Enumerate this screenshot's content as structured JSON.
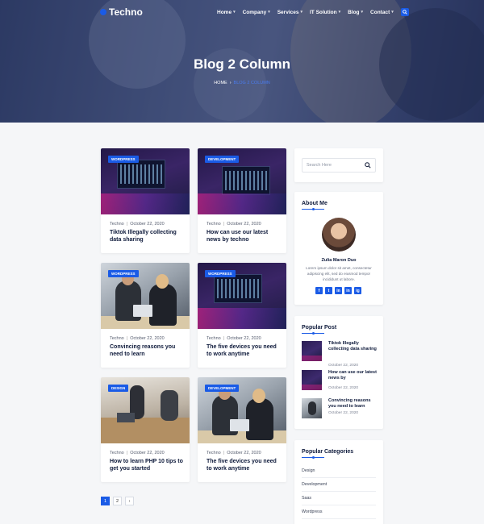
{
  "site": {
    "logo": "Techno"
  },
  "nav": [
    {
      "label": "Home",
      "caret": "▾"
    },
    {
      "label": "Company",
      "caret": "▾"
    },
    {
      "label": "Services",
      "caret": "▾"
    },
    {
      "label": "IT Solution",
      "caret": "▾"
    },
    {
      "label": "Blog",
      "caret": "▾"
    },
    {
      "label": "Contact",
      "caret": "▾"
    }
  ],
  "hero": {
    "title": "Blog 2 Column",
    "breadcrumb": {
      "home": "HOME",
      "separator": "›",
      "current": "BLOG 2 COLUMN"
    }
  },
  "posts": [
    {
      "tag": "WORDPRESS",
      "author": "Techno",
      "date": "October 22, 2020",
      "title": "Tiktok Illegally collecting data sharing",
      "image": "tech"
    },
    {
      "tag": "DEVELOPMENT",
      "author": "Techno",
      "date": "October 22, 2020",
      "title": "How can use our latest news by techno",
      "image": "tech"
    },
    {
      "tag": "WORDPRESS",
      "author": "Techno",
      "date": "October 22, 2020",
      "title": "Convincing reasons you need to learn",
      "image": "office"
    },
    {
      "tag": "WORDPRESS",
      "author": "Techno",
      "date": "October 22, 2020",
      "title": "The five devices you need to work anytime",
      "image": "tech"
    },
    {
      "tag": "DESIGN",
      "author": "Techno",
      "date": "October 22, 2020",
      "title": "How to learn PHP 10 tips to get you started",
      "image": "meeting"
    },
    {
      "tag": "DEVELOPMENT",
      "author": "Techno",
      "date": "October 22, 2020",
      "title": "The five devices you need to work anytime",
      "image": "office"
    }
  ],
  "pagination": {
    "pages": [
      "1",
      "2"
    ],
    "next": "›",
    "current": "1"
  },
  "sidebar": {
    "search": {
      "placeholder": "Search Here"
    },
    "about": {
      "title": "About Me",
      "name": "Zulia Maron Duo",
      "text": "Lorem ipsum dolor sit amet, consectetur adipiscing elit, sed do eiusmod tempor incididunt ut labore.",
      "socials": [
        "f",
        "t",
        "in",
        "in",
        "ig"
      ]
    },
    "popular": {
      "title": "Popular Post",
      "items": [
        {
          "title": "Tiktok Illegally collecting data sharing",
          "date": "October 22, 2020",
          "image": "tech"
        },
        {
          "title": "How can use our latest news by",
          "date": "October 22, 2020",
          "image": "tech"
        },
        {
          "title": "Convincing reasons you need to learn",
          "date": "October 22, 2020",
          "image": "office"
        }
      ]
    },
    "categories": {
      "title": "Popular Categories",
      "items": [
        "Design",
        "Development",
        "Saas",
        "Wordpress"
      ]
    }
  },
  "colors": {
    "accent": "#1a5be6",
    "heading": "#0e1a3b"
  }
}
